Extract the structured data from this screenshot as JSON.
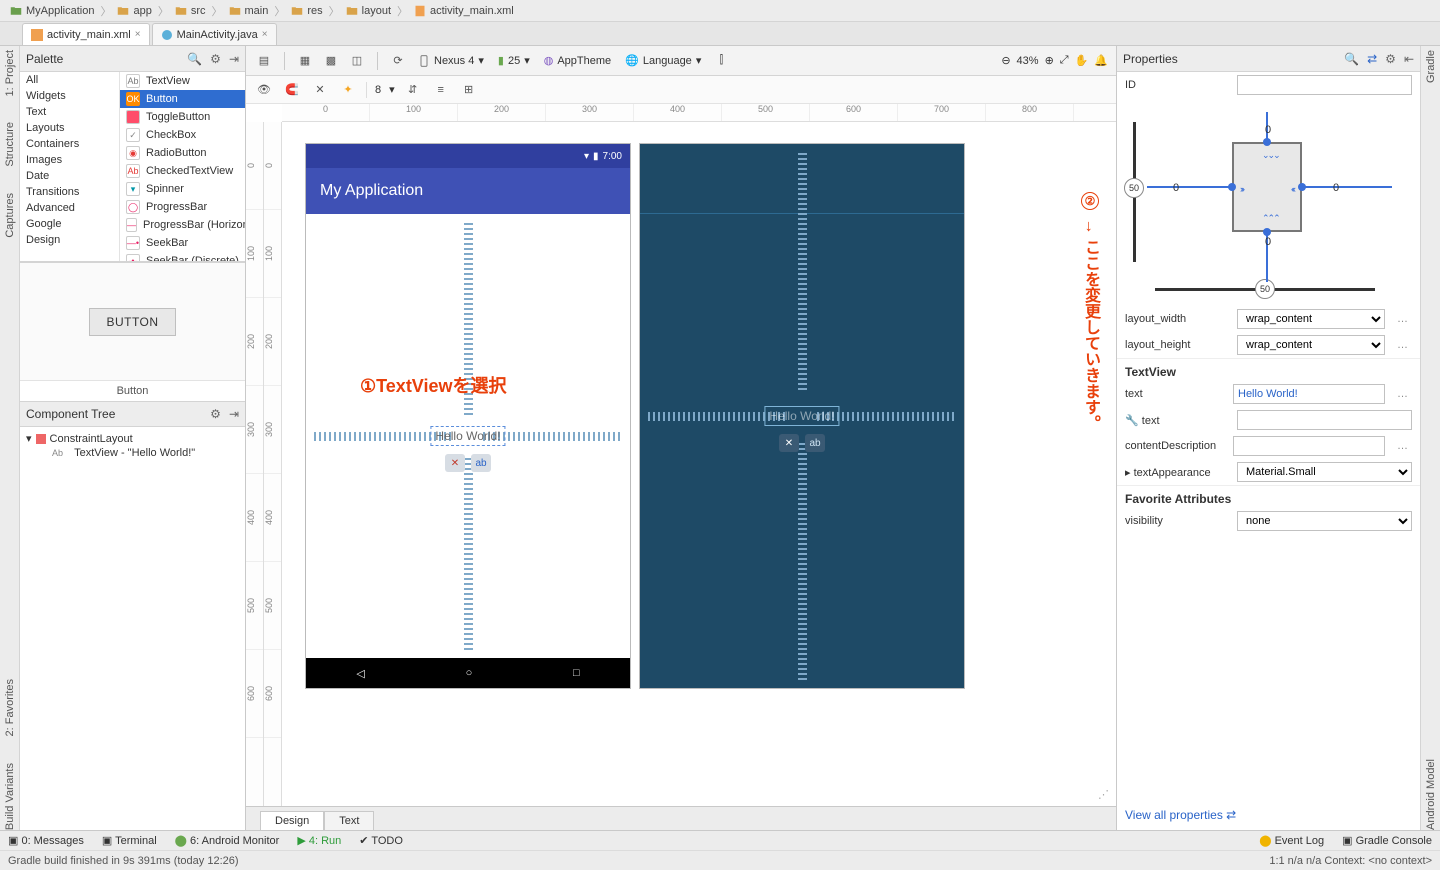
{
  "breadcrumbs": [
    "MyApplication",
    "app",
    "src",
    "main",
    "res",
    "layout",
    "activity_main.xml"
  ],
  "openTabs": [
    {
      "label": "activity_main.xml",
      "active": true,
      "icon": "layout"
    },
    {
      "label": "MainActivity.java",
      "active": false,
      "icon": "class"
    }
  ],
  "sideTabsLeft": [
    {
      "label": "1: Project",
      "icon": "project"
    },
    {
      "label": "Structure",
      "icon": "structure"
    },
    {
      "label": "Captures",
      "icon": "captures"
    }
  ],
  "sideTabsLeft2": [
    {
      "label": "2: Favorites",
      "icon": "star"
    },
    {
      "label": "Build Variants",
      "icon": "variant"
    }
  ],
  "sideTabsRight": [
    {
      "label": "Gradle",
      "icon": "gradle"
    },
    {
      "label": "Android Model",
      "icon": "android"
    }
  ],
  "palette": {
    "title": "Palette",
    "categories": [
      "All",
      "Widgets",
      "Text",
      "Layouts",
      "Containers",
      "Images",
      "Date",
      "Transitions",
      "Advanced",
      "Google",
      "Design"
    ],
    "items": [
      {
        "label": "TextView",
        "iconText": "Ab",
        "iconBg": "#fff",
        "iconColor": "#7a7a7a"
      },
      {
        "label": "Button",
        "iconText": "OK",
        "iconBg": "#ff8a00",
        "iconColor": "#fff",
        "selected": true
      },
      {
        "label": "ToggleButton",
        "iconText": "",
        "iconBg": "#ff4d6a"
      },
      {
        "label": "CheckBox",
        "iconText": "✓",
        "iconBg": "#fff",
        "iconColor": "#888"
      },
      {
        "label": "RadioButton",
        "iconText": "◉",
        "iconBg": "#fff",
        "iconColor": "#e53935"
      },
      {
        "label": "CheckedTextView",
        "iconText": "Ab",
        "iconBg": "#fff",
        "iconColor": "#e53935"
      },
      {
        "label": "Spinner",
        "iconText": "▾",
        "iconBg": "#fff",
        "iconColor": "#0097a7"
      },
      {
        "label": "ProgressBar",
        "iconText": "◯",
        "iconBg": "#fff",
        "iconColor": "#e91e63"
      },
      {
        "label": "ProgressBar (Horizontal)",
        "iconText": "—",
        "iconBg": "#fff",
        "iconColor": "#e91e63"
      },
      {
        "label": "SeekBar",
        "iconText": "—•",
        "iconBg": "#fff",
        "iconColor": "#e91e63"
      },
      {
        "label": "SeekBar (Discrete)",
        "iconText": "-•-",
        "iconBg": "#fff",
        "iconColor": "#e91e63"
      }
    ],
    "previewButton": "BUTTON",
    "previewLabel": "Button"
  },
  "componentTree": {
    "title": "Component Tree",
    "root": "ConstraintLayout",
    "child": "TextView - \"Hello World!\""
  },
  "toolbar1": {
    "device": "Nexus 4",
    "api": "25",
    "theme": "AppTheme",
    "lang": "Language",
    "zoom": "43%"
  },
  "toolbar2": {
    "gap": "8"
  },
  "rulerH": [
    "0",
    "100",
    "200",
    "300",
    "400",
    "500",
    "600",
    "700",
    "800"
  ],
  "rulerV": [
    "0",
    "100",
    "200",
    "300",
    "400",
    "500",
    "600"
  ],
  "preview": {
    "statusTime": "7:00",
    "appTitle": "My Application",
    "helloText": "Hello World!"
  },
  "annotations": {
    "a1": "①TextViewを選択",
    "a2num": "②",
    "a2arrow": "→",
    "a2": "ここを変更していきます。"
  },
  "designTabs": {
    "design": "Design",
    "text": "Text"
  },
  "properties": {
    "title": "Properties",
    "id_label": "ID",
    "id_value": "",
    "constraints": {
      "t": "0",
      "b": "0",
      "l": "0",
      "r": "0",
      "biasV": "50",
      "biasH": "50"
    },
    "layout_width_label": "layout_width",
    "layout_width": "wrap_content",
    "layout_height_label": "layout_height",
    "layout_height": "wrap_content",
    "section": "TextView",
    "text_label": "text",
    "text": "Hello World!",
    "text2_label": "text",
    "text2": "",
    "contentDesc_label": "contentDescription",
    "contentDesc": "",
    "textAppearance_label": "textAppearance",
    "textAppearance": "Material.Small",
    "fav_section": "Favorite Attributes",
    "visibility_label": "visibility",
    "visibility": "none",
    "viewAll": "View all properties"
  },
  "bottomTools": {
    "messages": "0: Messages",
    "terminal": "Terminal",
    "monitor": "6: Android Monitor",
    "run": "4: Run",
    "todo": "TODO",
    "eventLog": "Event Log",
    "gradleConsole": "Gradle Console"
  },
  "statusLine": {
    "left": "Gradle build finished in 9s 391ms (today 12:26)",
    "right": "1:1   n/a   n/a   Context: <no context>"
  }
}
